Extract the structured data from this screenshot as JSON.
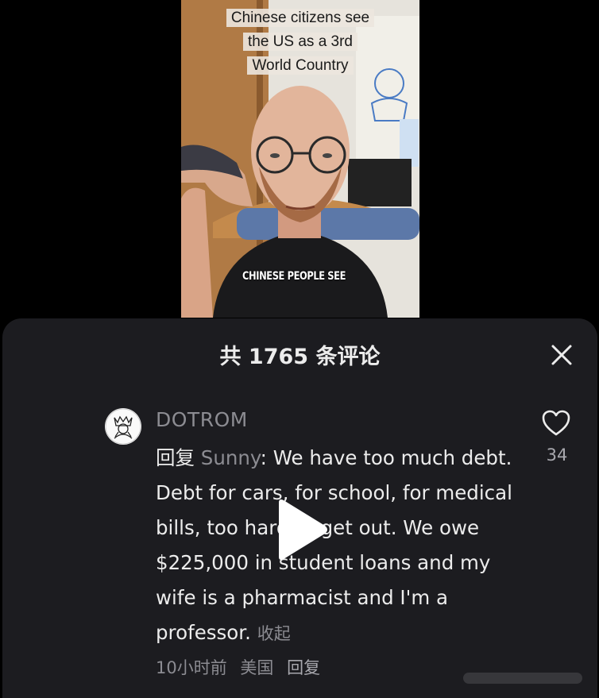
{
  "video": {
    "overlay_title_lines": [
      "Chinese citizens see",
      "the US as a 3rd",
      "World Country"
    ],
    "subtitle": "CHINESE PEOPLE SEE"
  },
  "comments_panel": {
    "title": "共 1765 条评论",
    "close_icon": "close-icon"
  },
  "comment": {
    "username": "DOTROM",
    "reply_prefix": "回复 ",
    "reply_to": "Sunny",
    "body": ": We have too much debt. Debt for cars, for school, for medical bills, too hard to get out. We owe $225,000 in student loans and my wife is a pharmacist and I'm a professor. ",
    "collapse_label": "收起",
    "time": "10小时前",
    "location": "美国",
    "reply_label": "回复",
    "like_count": "34",
    "like_icon": "heart-outline-icon"
  },
  "player": {
    "play_icon": "play-icon"
  },
  "colors": {
    "sheet_bg": "#1c1c20",
    "primary_text": "#ececec",
    "secondary_text": "#8c8c92"
  }
}
